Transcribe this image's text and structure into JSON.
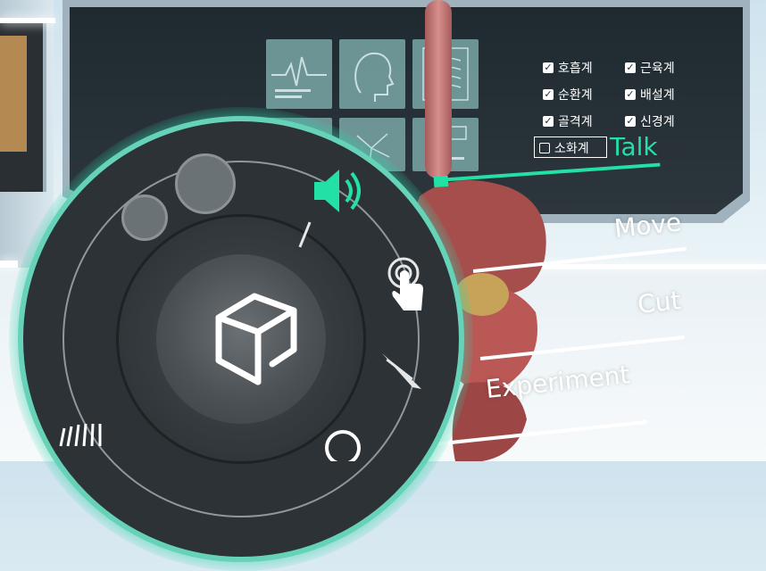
{
  "monitor": {
    "thumbnails": [
      "ecg-icon",
      "head-scan-icon",
      "xray-chest-icon",
      "tissue-icon",
      "neuron-icon",
      "chart-icon"
    ],
    "systems": [
      {
        "label": "호흡계",
        "checked": true
      },
      {
        "label": "근육계",
        "checked": true
      },
      {
        "label": "순환계",
        "checked": true
      },
      {
        "label": "배설계",
        "checked": true
      },
      {
        "label": "골격계",
        "checked": true
      },
      {
        "label": "신경계",
        "checked": true
      },
      {
        "label": "소화계",
        "checked": false
      }
    ]
  },
  "menu": {
    "talk": "Talk",
    "move": "Move",
    "cut": "Cut",
    "experiment": "Experiment"
  },
  "dial": {
    "center_icon": "cube-icon",
    "tools": [
      "speaker-icon",
      "touch-icon",
      "scalpel-icon",
      "magnifier-icon"
    ]
  },
  "colors": {
    "accent": "#22e0a6",
    "dial_glow": "#66d2b8"
  }
}
